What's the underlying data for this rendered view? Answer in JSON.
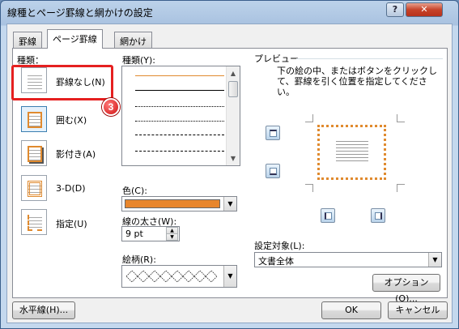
{
  "window": {
    "title": "線種とページ罫線と網かけの設定",
    "help": "?",
    "close": "✕"
  },
  "tabs": [
    {
      "label": "罫線"
    },
    {
      "label": "ページ罫線"
    },
    {
      "label": "網かけ"
    }
  ],
  "setting": {
    "label": "種類：",
    "options": [
      {
        "label": "罫線なし(N)",
        "icon": "no-border-icon"
      },
      {
        "label": "囲む(X)",
        "icon": "box-border-icon"
      },
      {
        "label": "影付き(A)",
        "icon": "shadow-border-icon"
      },
      {
        "label": "3-D(D)",
        "icon": "3d-border-icon"
      },
      {
        "label": "指定(U)",
        "icon": "custom-border-icon"
      }
    ]
  },
  "callout": {
    "step": "3",
    "color": "#e52020"
  },
  "style": {
    "label": "種類(Y):"
  },
  "color": {
    "label": "色(C):",
    "value": "#e8862c"
  },
  "width": {
    "label": "線の太さ(W):",
    "value": "9 pt"
  },
  "art": {
    "label": "絵柄(R):"
  },
  "preview": {
    "label": "プレビュー",
    "instruction": "下の絵の中、またはボタンをクリックして、罫線を引く位置を指定してください。",
    "border_color": "#e08a2e"
  },
  "apply_to": {
    "label": "設定対象(L):",
    "value": "文書全体"
  },
  "buttons": {
    "options": "オプション(O)...",
    "horizontal_line": "水平線(H)...",
    "ok": "OK",
    "cancel": "キャンセル"
  }
}
